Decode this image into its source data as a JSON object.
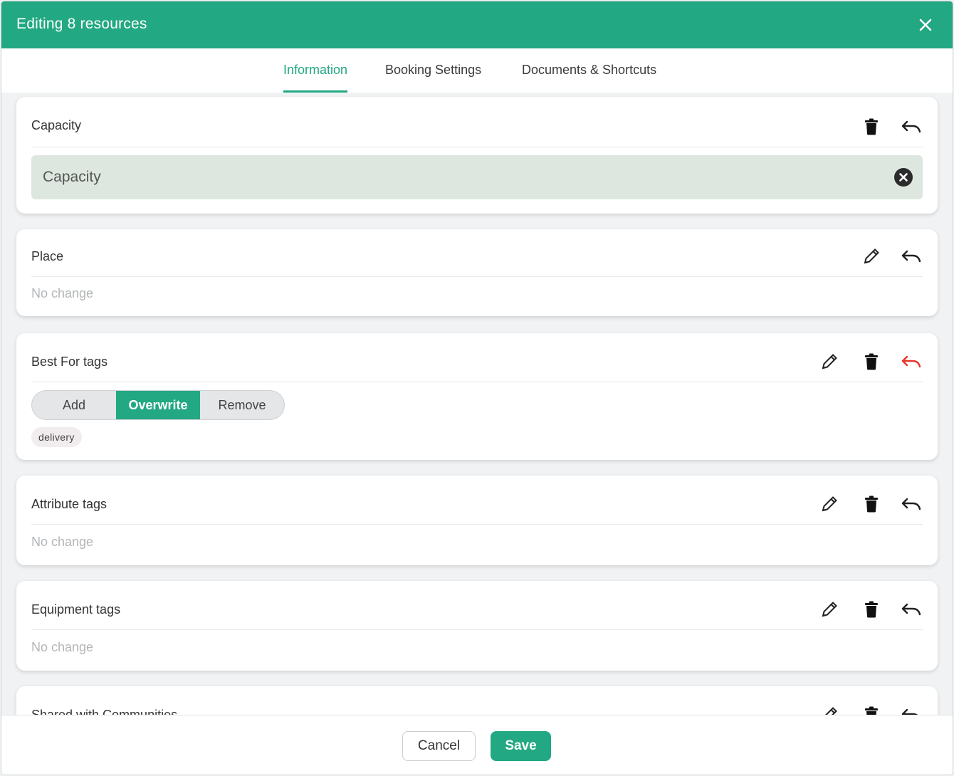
{
  "dialog": {
    "title": "Editing 8 resources",
    "close_icon": "close-icon"
  },
  "tabs": [
    {
      "label": "Information",
      "active": true
    },
    {
      "label": "Booking Settings",
      "active": false
    },
    {
      "label": "Documents & Shortcuts",
      "active": false
    }
  ],
  "cards": {
    "capacity": {
      "label": "Capacity",
      "input_placeholder": "Capacity",
      "icons": [
        "trash-icon",
        "undo-icon",
        "clear-circle-icon"
      ]
    },
    "place": {
      "label": "Place",
      "status": "No change",
      "icons": [
        "pencil-icon",
        "undo-icon"
      ]
    },
    "best_for_tags": {
      "label": "Best For tags",
      "modes": [
        "Add",
        "Overwrite",
        "Remove"
      ],
      "selected_mode": "Overwrite",
      "tags": [
        "delivery"
      ],
      "icons": [
        "pencil-icon",
        "trash-icon",
        "undo-icon"
      ]
    },
    "attribute_tags": {
      "label": "Attribute tags",
      "status": "No change",
      "icons": [
        "pencil-icon",
        "trash-icon",
        "undo-icon"
      ]
    },
    "equipment_tags": {
      "label": "Equipment tags",
      "status": "No change",
      "icons": [
        "pencil-icon",
        "trash-icon",
        "undo-icon"
      ]
    },
    "shared_with_communities": {
      "label": "Shared with Communities",
      "icons": [
        "pencil-icon",
        "trash-icon",
        "undo-icon"
      ]
    }
  },
  "footer": {
    "cancel_label": "Cancel",
    "save_label": "Save"
  },
  "colors": {
    "brand": "#22a882",
    "undo_active": "#e8352b",
    "input_bg": "#dde7df"
  }
}
